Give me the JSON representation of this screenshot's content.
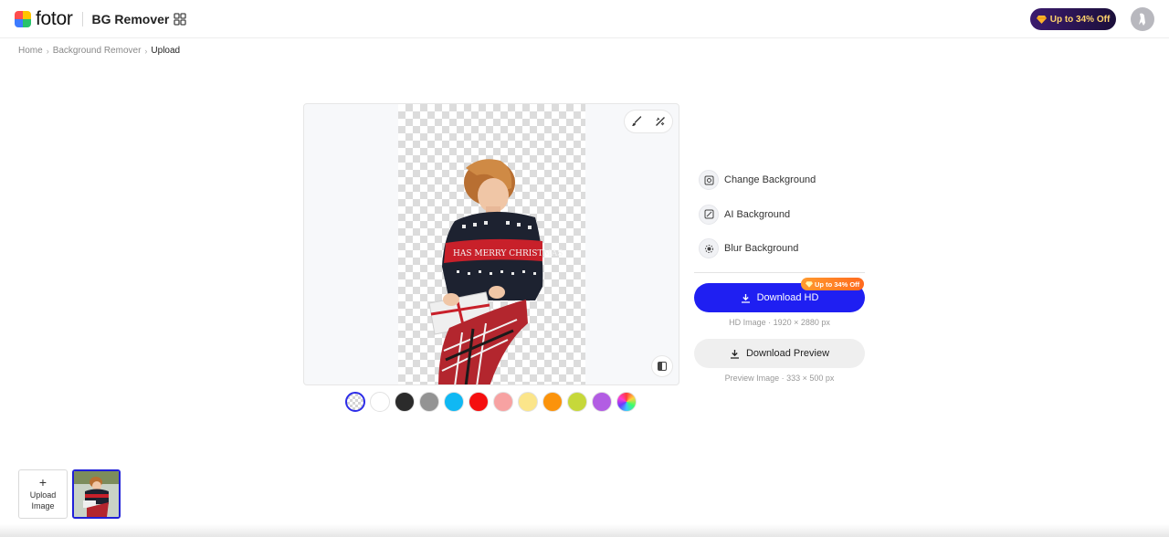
{
  "header": {
    "logo_text": "fotor",
    "product_name": "BG Remover",
    "promo_label": "Up to 34% Off",
    "icons": [
      "apps-grid-icon",
      "gem-icon",
      "user-avatar-icon"
    ]
  },
  "breadcrumb": {
    "items": [
      "Home",
      "Background Remover",
      "Upload"
    ]
  },
  "canvas": {
    "tools": [
      "brush-icon",
      "eraser-icon"
    ],
    "compare_icon": "compare-icon"
  },
  "swatches": {
    "colors": [
      "transparent",
      "#ffffff",
      "#2b2b2b",
      "#939393",
      "#10b8f3",
      "#f50f0f",
      "#f7a2a2",
      "#fbe58a",
      "#fb930b",
      "#c6d83a",
      "#b25de3",
      "rainbow"
    ],
    "selected": "transparent"
  },
  "options": [
    {
      "label": "Change Background",
      "icon": "change-background-icon"
    },
    {
      "label": "AI Background",
      "icon": "ai-background-icon"
    },
    {
      "label": "Blur Background",
      "icon": "blur-background-icon"
    }
  ],
  "download_hd": {
    "label": "Download HD",
    "badge": "Up to 34% Off",
    "caption": "HD Image · 1920 × 2880 px"
  },
  "download_preview": {
    "label": "Download Preview",
    "caption": "Preview Image · 333 × 500 px"
  },
  "upload": {
    "label_line1": "Upload",
    "label_line2": "Image"
  },
  "colors": {
    "accent": "#1f1ff2",
    "promo_bg": "#2a1556",
    "promo_text": "#ffd46b",
    "badge": "#ff8a25"
  }
}
